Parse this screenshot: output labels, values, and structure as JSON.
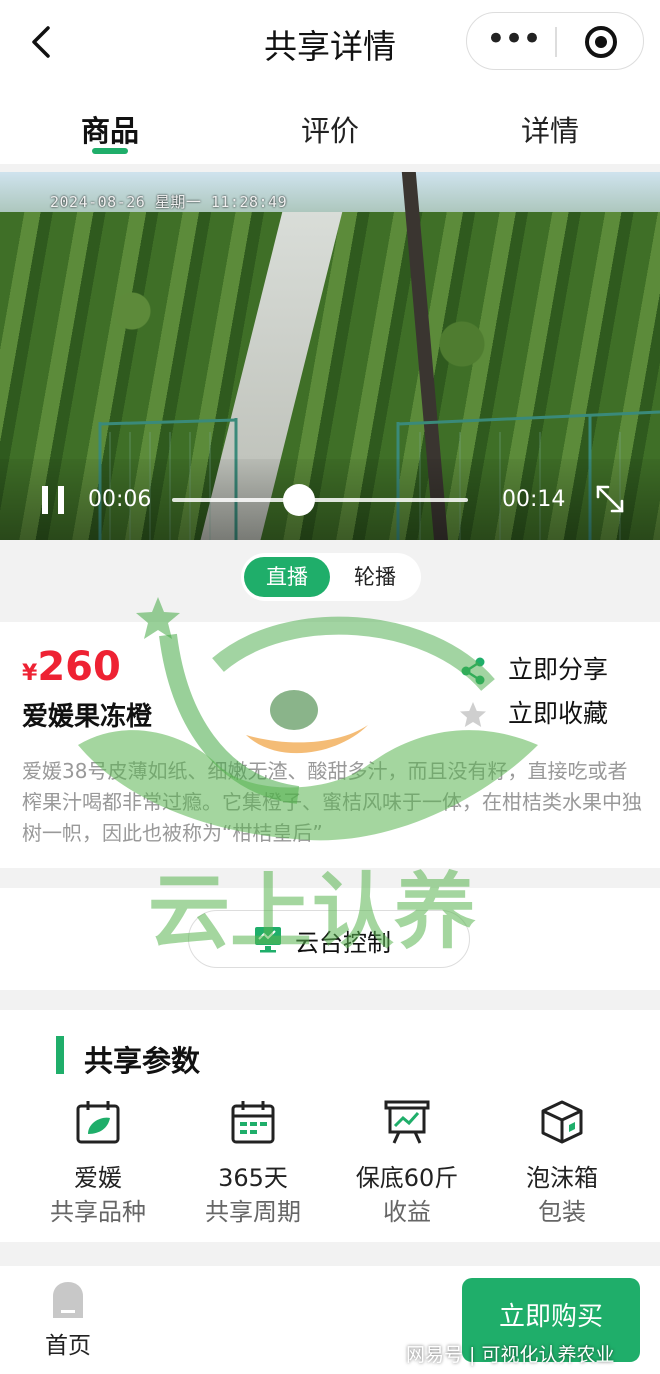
{
  "header": {
    "title": "共享详情",
    "more_icon": "more-dots-icon",
    "close_icon": "target-icon",
    "back_icon": "back-arrow-icon"
  },
  "tabs": [
    {
      "label": "商品",
      "active": true
    },
    {
      "label": "评价",
      "active": false
    },
    {
      "label": "详情",
      "active": false
    }
  ],
  "video": {
    "timestamp": "2024-08-26 星期一 11:28:49",
    "current_time": "00:06",
    "total_time": "00:14",
    "progress": 0.43,
    "play_state_icon": "pause-icon",
    "fullscreen_icon": "fullscreen-icon"
  },
  "mode": {
    "live": "直播",
    "carousel": "轮播",
    "selected": "直播"
  },
  "product": {
    "currency": "¥",
    "price": "260",
    "name": "爱媛果冻橙",
    "share_label": "立即分享",
    "favorite_label": "立即收藏",
    "description": "爱媛38号皮薄如纸、细嫩无渣、酸甜多汁，而且没有籽，直接吃或者榨果汁喝都非常过瘾。它集橙子、蜜桔风味于一体，在柑桔类水果中独树一帜，因此也被称为“柑桔皇后”"
  },
  "ptz": {
    "label": "云台控制",
    "icon": "monitor-icon"
  },
  "watermark": {
    "text": "云上认养"
  },
  "params": {
    "title": "共享参数",
    "items": [
      {
        "value": "爱媛",
        "key": "共享品种",
        "icon": "calendar-leaf-icon"
      },
      {
        "value": "365天",
        "key": "共享周期",
        "icon": "calendar-icon"
      },
      {
        "value": "保底60斤",
        "key": "收益",
        "icon": "chart-board-icon"
      },
      {
        "value": "泡沫箱",
        "key": "包装",
        "icon": "box-icon"
      }
    ]
  },
  "bottom": {
    "home_label": "首页",
    "buy_label": "立即购买",
    "credit": "网易号 | 可视化认养农业"
  },
  "colors": {
    "accent": "#1fae6a",
    "price": "#e23333"
  }
}
